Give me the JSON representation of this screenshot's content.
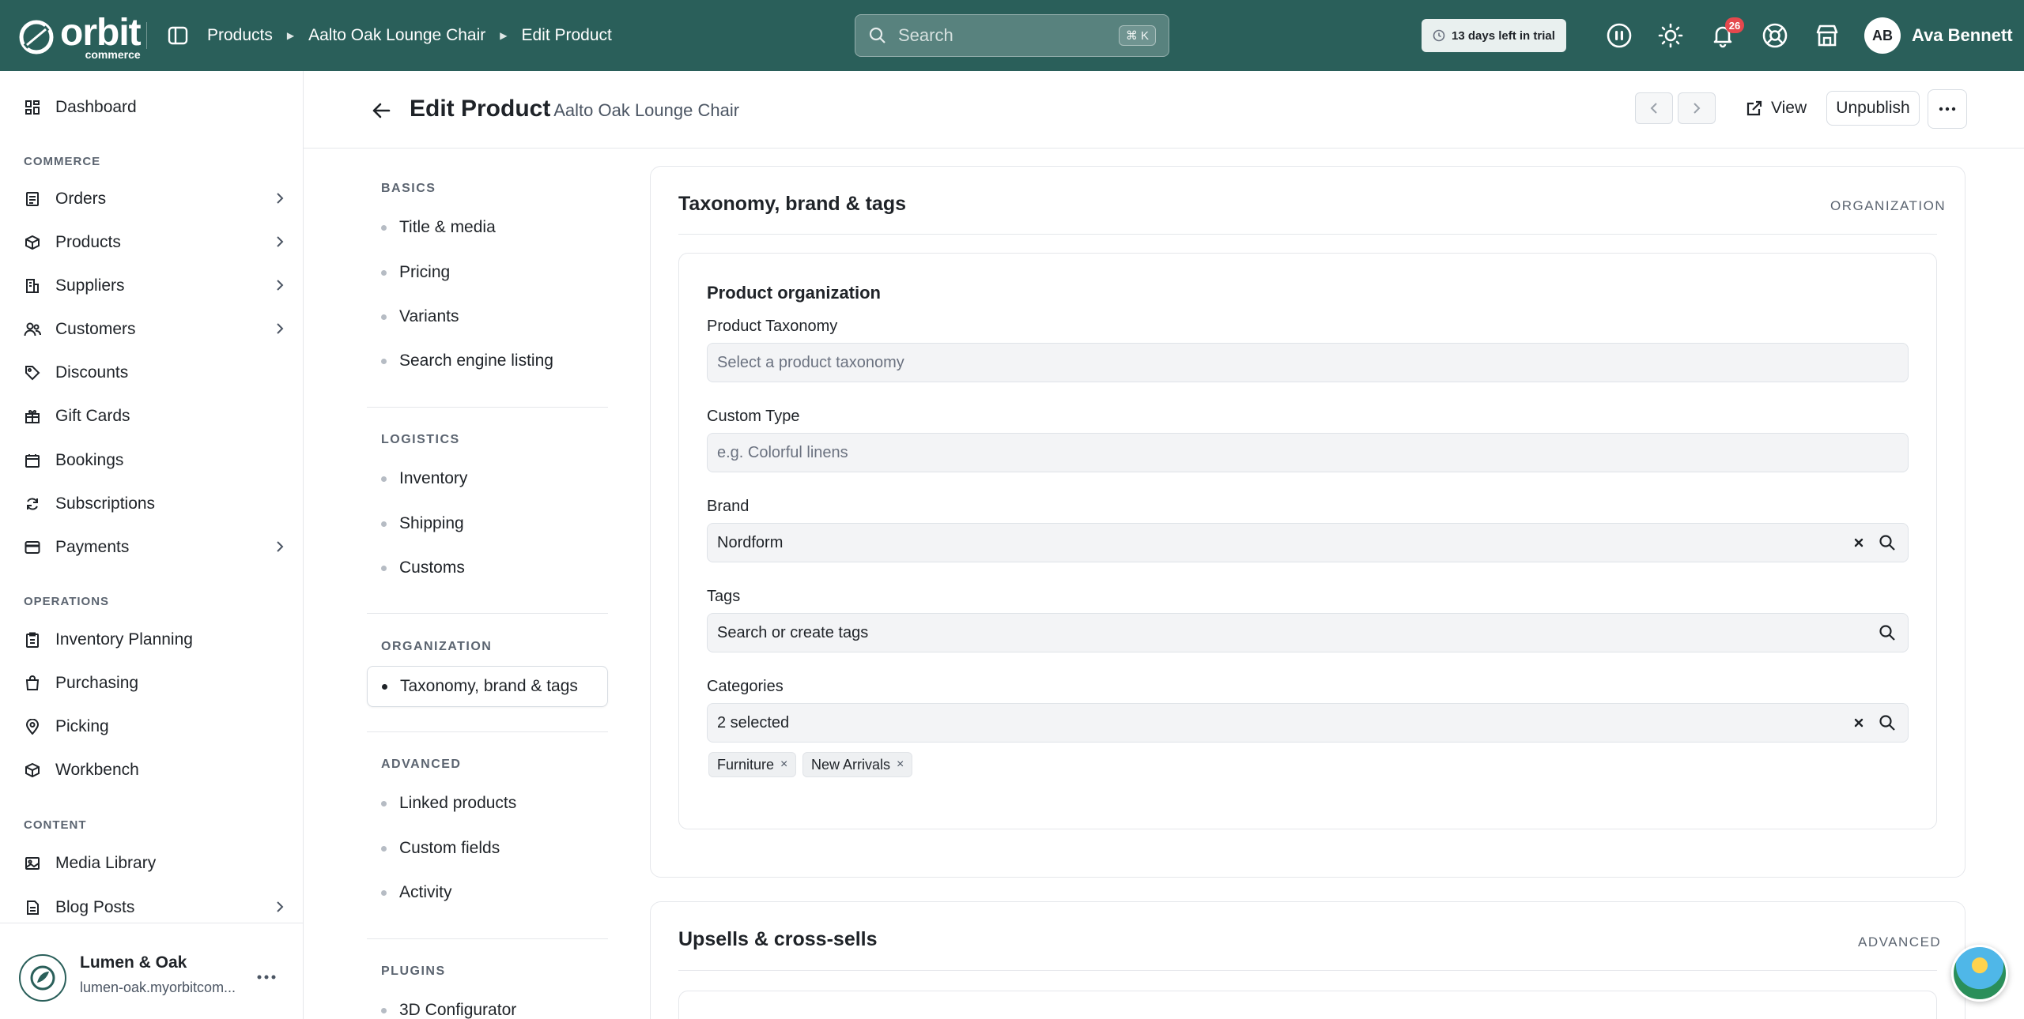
{
  "topbar": {
    "brand": {
      "name": "orbit",
      "sub": "commerce"
    },
    "breadcrumbs": [
      "Products",
      "Aalto Oak Lounge Chair",
      "Edit Product"
    ],
    "search": {
      "placeholder": "Search",
      "shortcut": "⌘ K"
    },
    "trial": "13 days left in trial",
    "notifications_count": "26",
    "user": {
      "initials": "AB",
      "name": "Ava Bennett"
    },
    "icons": [
      "support-icon",
      "theme-sun-icon",
      "bell-icon",
      "help-lifebuoy-icon",
      "storefront-icon"
    ]
  },
  "sidebar": {
    "top_items": [
      {
        "label": "Dashboard",
        "icon": "dashboard-icon"
      }
    ],
    "sections": [
      {
        "label": "COMMERCE",
        "items": [
          {
            "label": "Orders",
            "icon": "orders-icon",
            "has_children": true
          },
          {
            "label": "Products",
            "icon": "box-icon",
            "has_children": true
          },
          {
            "label": "Suppliers",
            "icon": "building-icon",
            "has_children": true
          },
          {
            "label": "Customers",
            "icon": "users-icon",
            "has_children": true
          },
          {
            "label": "Discounts",
            "icon": "tag-icon",
            "has_children": false
          },
          {
            "label": "Gift Cards",
            "icon": "gift-icon",
            "has_children": false
          },
          {
            "label": "Bookings",
            "icon": "calendar-icon",
            "has_children": false
          },
          {
            "label": "Subscriptions",
            "icon": "refresh-icon",
            "has_children": false
          },
          {
            "label": "Payments",
            "icon": "card-icon",
            "has_children": true
          }
        ]
      },
      {
        "label": "OPERATIONS",
        "items": [
          {
            "label": "Inventory Planning",
            "icon": "clipboard-icon"
          },
          {
            "label": "Purchasing",
            "icon": "bag-icon"
          },
          {
            "label": "Picking",
            "icon": "pin-icon"
          },
          {
            "label": "Workbench",
            "icon": "cube-icon"
          }
        ]
      },
      {
        "label": "CONTENT",
        "items": [
          {
            "label": "Media Library",
            "icon": "image-icon",
            "has_children": false
          },
          {
            "label": "Blog Posts",
            "icon": "document-icon",
            "has_children": true
          }
        ]
      }
    ],
    "store": {
      "name": "Lumen & Oak",
      "url": "lumen-oak.myorbitcom..."
    }
  },
  "header": {
    "title": "Edit Product",
    "subtitle": "· Aalto Oak Lounge Chair",
    "view_label": "View",
    "unpublish_label": "Unpublish"
  },
  "section_nav": {
    "groups": [
      {
        "label": "BASICS",
        "items": [
          "Title & media",
          "Pricing",
          "Variants",
          "Search engine listing"
        ]
      },
      {
        "label": "LOGISTICS",
        "items": [
          "Inventory",
          "Shipping",
          "Customs"
        ]
      },
      {
        "label": "ORGANIZATION",
        "items": [
          "Taxonomy, brand & tags"
        ]
      },
      {
        "label": "ADVANCED",
        "items": [
          "Linked products",
          "Custom fields",
          "Activity"
        ]
      },
      {
        "label": "PLUGINS",
        "items": [
          "3D Configurator"
        ]
      }
    ],
    "active": "Taxonomy, brand & tags"
  },
  "taxonomy_card": {
    "title": "Taxonomy, brand & tags",
    "tag": "ORGANIZATION",
    "group_title": "Product organization",
    "fields": {
      "taxonomy": {
        "label": "Product Taxonomy",
        "placeholder": "Select a product taxonomy"
      },
      "custom_type": {
        "label": "Custom Type",
        "placeholder": "e.g. Colorful linens"
      },
      "brand": {
        "label": "Brand",
        "value": "Nordform"
      },
      "tags": {
        "label": "Tags",
        "placeholder": "Search or create tags"
      },
      "categories": {
        "label": "Categories",
        "value": "2 selected",
        "chips": [
          "Furniture",
          "New Arrivals"
        ]
      }
    }
  },
  "upsells_card": {
    "title": "Upsells & cross-sells",
    "tag": "ADVANCED"
  }
}
